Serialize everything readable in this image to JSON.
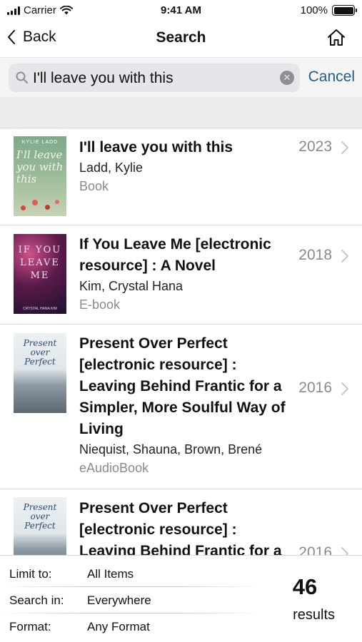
{
  "status_bar": {
    "carrier": "Carrier",
    "time": "9:41 AM",
    "battery": "100%"
  },
  "nav": {
    "back_label": "Back",
    "title": "Search"
  },
  "search": {
    "query": "I'll leave you with this",
    "cancel_label": "Cancel"
  },
  "results": [
    {
      "title": "I'll leave you with this",
      "author": "Ladd, Kylie",
      "format": "Book",
      "year": "2023",
      "cover_text": "KYLIE LADD"
    },
    {
      "title": "If You Leave Me [electronic resource] : A Novel",
      "author": "Kim, Crystal Hana",
      "format": "E-book",
      "year": "2018",
      "cover_text": "IF YOU LEAVE ME"
    },
    {
      "title": "Present Over Perfect [electronic resource] : Leaving Behind Frantic for a Simpler, More Soulful Way of Living",
      "author": "Niequist, Shauna, Brown, Brené",
      "format": "eAudioBook",
      "year": "2016",
      "cover_text": "Present over Perfect"
    },
    {
      "title": "Present Over Perfect [electronic resource] : Leaving Behind Frantic for a",
      "author": "",
      "format": "",
      "year": "2016",
      "cover_text": "Present over Perfect"
    }
  ],
  "filters": [
    {
      "label": "Limit to:",
      "value": "All Items"
    },
    {
      "label": "Search in:",
      "value": "Everywhere"
    },
    {
      "label": "Format:",
      "value": "Any Format"
    }
  ],
  "summary": {
    "count": "46",
    "label": "results"
  },
  "colors": {
    "accent": "#1f5c8c",
    "secondary_text": "#8a8a8e"
  },
  "icons": [
    "signal-icon",
    "wifi-icon",
    "battery-icon",
    "back-chevron-icon",
    "home-icon",
    "search-icon",
    "clear-icon",
    "chevron-right-icon"
  ]
}
